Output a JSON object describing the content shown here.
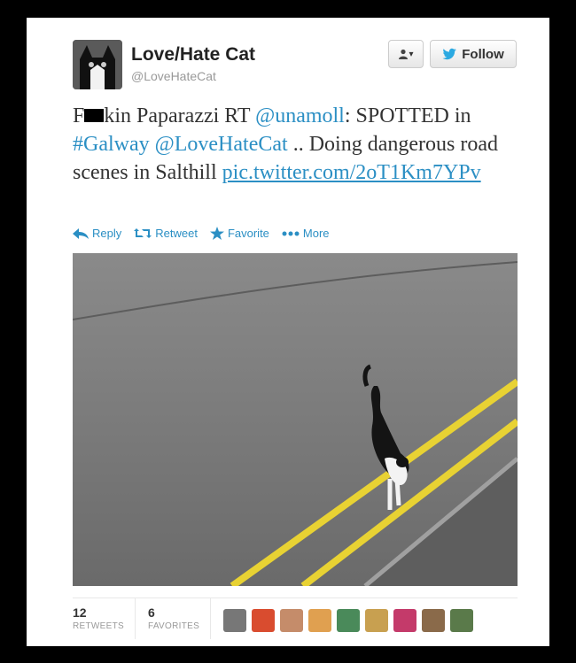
{
  "user": {
    "name": "Love/Hate Cat",
    "handle": "@LoveHateCat"
  },
  "buttons": {
    "user_menu": "▾",
    "follow": "Follow"
  },
  "tweet": {
    "part1": "F",
    "part2": "kin Paparazzi RT ",
    "mention1": "@unamoll",
    "part3": ": SPOTTED in ",
    "hashtag": "#Galway",
    "part4": " ",
    "mention2": "@LoveHateCat",
    "part5": " .. Doing dangerous road scenes in Salthill ",
    "link": "pic.twitter.com/2oT1Km7YPv"
  },
  "actions": {
    "reply": "Reply",
    "retweet": "Retweet",
    "favorite": "Favorite",
    "more": "More"
  },
  "stats": {
    "retweets_count": "12",
    "retweets_label": "RETWEETS",
    "favorites_count": "6",
    "favorites_label": "FAVORITES"
  },
  "colors": {
    "link": "#2b8fc4",
    "twitter_blue": "#2ba9e1"
  },
  "icons": [
    "person-icon",
    "twitter-bird-icon",
    "reply-icon",
    "retweet-icon",
    "star-icon",
    "more-dots-icon"
  ]
}
